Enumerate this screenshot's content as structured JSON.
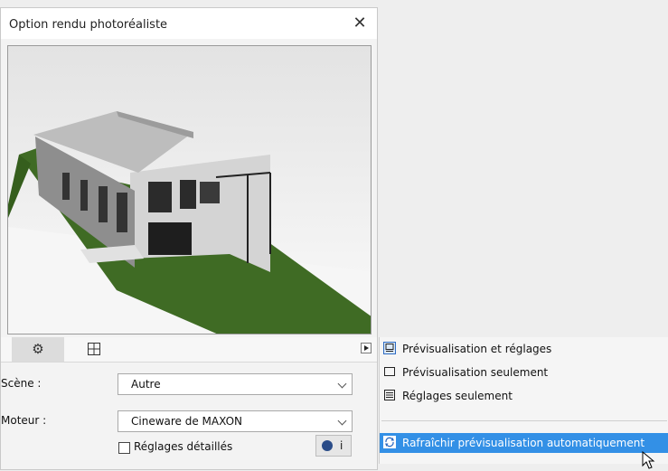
{
  "panel": {
    "title": "Option rendu photoréaliste",
    "close_label": "✕"
  },
  "tabs": [
    {
      "icon": "gear-icon"
    },
    {
      "icon": "crosshair-grid-icon"
    }
  ],
  "scene": {
    "label": "Scène :",
    "value": "Autre"
  },
  "engine": {
    "label": "Moteur :",
    "value": "Cineware de MAXON"
  },
  "detailed": {
    "label": "Réglages détaillés",
    "checked": false
  },
  "info_button": {
    "label": "i"
  },
  "menu": {
    "items": [
      {
        "label": "Prévisualisation et réglages",
        "icon": "preview-settings-icon",
        "selected": true
      },
      {
        "label": "Prévisualisation seulement",
        "icon": "preview-only-icon"
      },
      {
        "label": "Réglages seulement",
        "icon": "settings-list-icon"
      },
      {
        "label": "Rafraîchir prévisualisation automatiquement",
        "icon": "refresh-icon",
        "highlighted": true
      }
    ]
  },
  "colors": {
    "highlight": "#3390e6",
    "grass": "#3f6b24"
  }
}
